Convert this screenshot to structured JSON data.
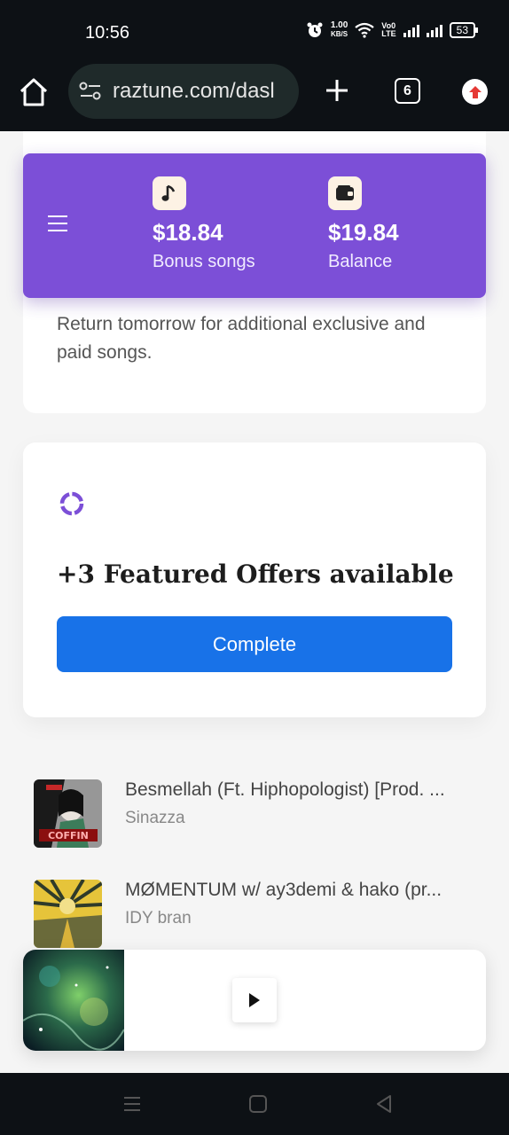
{
  "status_bar": {
    "time": "10:56",
    "speed_value": "1.00",
    "speed_unit": "KB/S",
    "net_top": "Vo0",
    "net_bottom": "LTE",
    "battery": "53"
  },
  "browser": {
    "url": "raztune.com/dasl",
    "tab_count": "6"
  },
  "wallet": {
    "bonus_value": "$18.84",
    "bonus_label": "Bonus songs",
    "balance_value": "$19.84",
    "balance_label": "Balance"
  },
  "message_card": {
    "text": "Return tomorrow for additional exclusive and paid songs."
  },
  "offers_card": {
    "title": "+3 Featured Offers available",
    "button_label": "Complete"
  },
  "tracks": [
    {
      "title": "Besmellah (Ft. Hiphopologist) [Prod. ...",
      "artist": "Sinazza"
    },
    {
      "title": "MØMENTUM w/ ay3demi & hako (pr...",
      "artist": "IDY bran"
    }
  ],
  "colors": {
    "accent_purple": "#7c4fd7",
    "button_blue": "#1872e8",
    "system_bar": "#0d1115"
  }
}
